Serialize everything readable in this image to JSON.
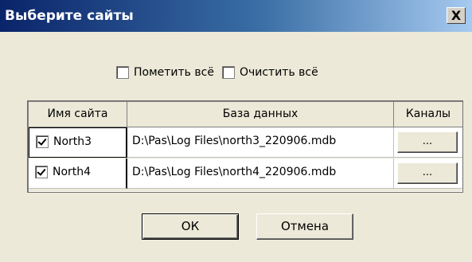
{
  "dialog": {
    "title": "Выберите сайты",
    "close_glyph": "X"
  },
  "toolbar": {
    "select_all_label": "Пометить всё",
    "select_all_checked": false,
    "clear_all_label": "Очистить всё",
    "clear_all_checked": false
  },
  "grid": {
    "columns": [
      "Имя сайта",
      "База данных",
      "Каналы"
    ],
    "rows": [
      {
        "site": "North3",
        "checked": true,
        "database": "D:\\Pas\\Log Files\\north3_220906.mdb",
        "channels_label": "..."
      },
      {
        "site": "North4",
        "checked": true,
        "database": "D:\\Pas\\Log Files\\north4_220906.mdb",
        "channels_label": "..."
      }
    ]
  },
  "buttons": {
    "ok_label": "ОК",
    "cancel_label": "Отмена"
  },
  "colors": {
    "title_start": "#0a246a",
    "title_end": "#a6caf0",
    "face": "#ece9d8"
  }
}
